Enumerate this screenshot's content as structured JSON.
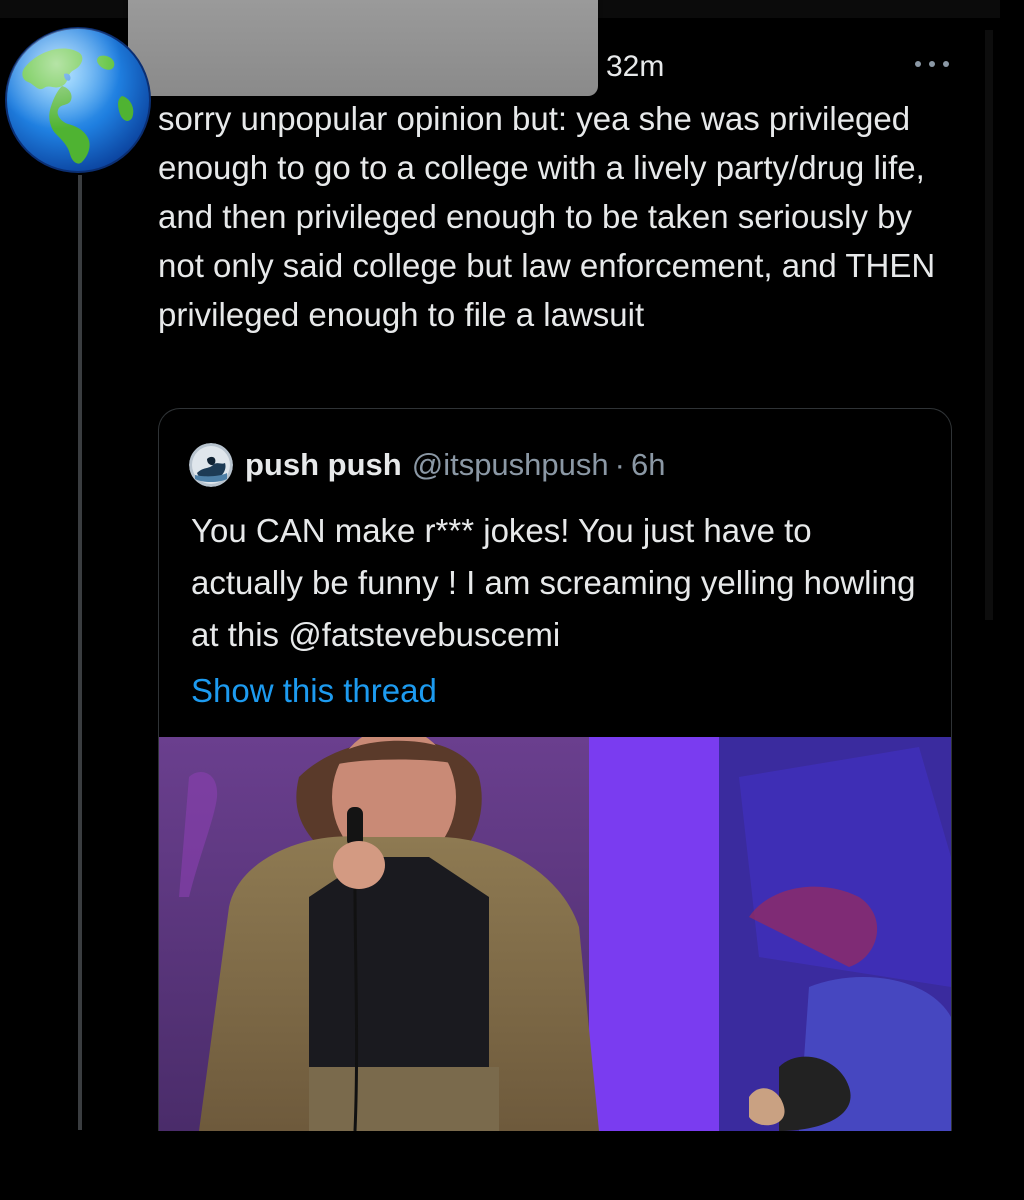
{
  "tweet": {
    "time": "32m",
    "text": "sorry unpopular opinion but: yea she was privileged enough to go to a college with a lively party/drug life, and then privileged enough to be taken seriously by not only said college but law enforcement, and THEN privileged enough to file a lawsuit",
    "more_icon": "more-horizontal-icon",
    "avatar_icon": "earth-globe-icon"
  },
  "quote": {
    "name": "push push",
    "handle": "@itspushpush",
    "separator": "·",
    "time": "6h",
    "text": "You CAN make r*** jokes! You just have to actually be funny ! I am screaming yelling howling at this @fatstevebuscemi",
    "show_thread": "Show this thread"
  },
  "colors": {
    "background": "#000000",
    "text": "#e7e9ea",
    "secondary": "#8b98a5",
    "link": "#1d9bf0",
    "border": "#2f3336"
  }
}
